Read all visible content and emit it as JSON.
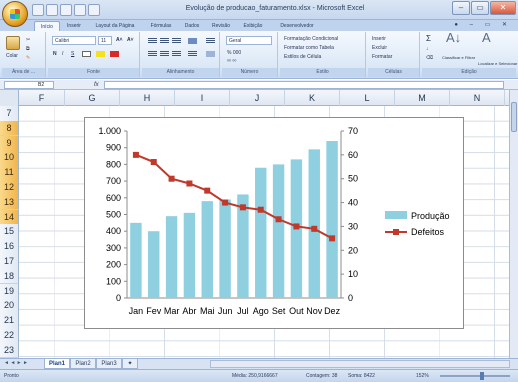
{
  "window": {
    "title": "Evolução de producao_faturamento.xlsx - Microsoft Excel",
    "controls": [
      "–",
      "▭",
      "✕"
    ]
  },
  "ribbon": {
    "tabs": [
      "Início",
      "Inserir",
      "Layout da Página",
      "Fórmulas",
      "Dados",
      "Revisão",
      "Exibição",
      "Desenvolvedor"
    ],
    "active_tab": "Início",
    "groups": {
      "clipboard": {
        "label": "Área de ...",
        "paste": "Colar"
      },
      "font": {
        "label": "Fonte",
        "font_name": "Calibri",
        "font_size": "11",
        "bold": "N",
        "italic": "I",
        "underline": "S"
      },
      "alignment": {
        "label": "Alinhamento"
      },
      "number": {
        "label": "Número",
        "format": "Geral",
        "percent": "% 000"
      },
      "styles": {
        "label": "Estilo",
        "items": [
          "Formatação Condicional",
          "Formatar como Tabela",
          "Estilos de Célula"
        ]
      },
      "cells": {
        "label": "Células",
        "items": [
          "Inserir",
          "Excluir",
          "Formatar"
        ]
      },
      "editing": {
        "label": "Edição",
        "sort": "Classificar e Filtrar",
        "find": "Localizar e Selecionar"
      }
    }
  },
  "formula_bar": {
    "name_box": "B2",
    "fx": "fx",
    "value": ""
  },
  "sheet": {
    "columns": [
      "F",
      "G",
      "H",
      "I",
      "J",
      "K",
      "L",
      "M",
      "N"
    ],
    "rows": [
      "7",
      "8",
      "9",
      "10",
      "11",
      "12",
      "13",
      "14",
      "15",
      "16",
      "17",
      "18",
      "19",
      "20",
      "21",
      "22",
      "23"
    ],
    "selected_rows": [
      "8",
      "9",
      "10",
      "11",
      "12",
      "13",
      "14"
    ]
  },
  "chart_data": {
    "type": "bar",
    "categories": [
      "Jan",
      "Fev",
      "Mar",
      "Abr",
      "Mai",
      "Jun",
      "Jul",
      "Ago",
      "Set",
      "Out",
      "Nov",
      "Dez"
    ],
    "series": [
      {
        "name": "Produção",
        "type": "bar",
        "axis": "left",
        "color": "#8ecfe0",
        "values": [
          450,
          400,
          490,
          510,
          580,
          590,
          620,
          780,
          800,
          830,
          890,
          940
        ]
      },
      {
        "name": "Defeitos",
        "type": "line",
        "axis": "right",
        "color": "#c0392b",
        "values": [
          60,
          57,
          50,
          48,
          45,
          40,
          38,
          37,
          33,
          30,
          29,
          25
        ]
      }
    ],
    "y_left": {
      "min": 0,
      "max": 1000,
      "ticks": [
        "0",
        "100",
        "200",
        "300",
        "400",
        "500",
        "600",
        "700",
        "800",
        "900",
        "1.000"
      ]
    },
    "y_right": {
      "min": 0,
      "max": 70,
      "ticks": [
        "0",
        "10",
        "20",
        "30",
        "40",
        "50",
        "60",
        "70"
      ]
    },
    "legend_position": "right",
    "gridlines": false
  },
  "sheet_tabs": {
    "tabs": [
      "Plan1",
      "Plan2",
      "Plan3"
    ],
    "active": "Plan1",
    "nav": "◄ ◄ ► ►"
  },
  "status_bar": {
    "mode": "Pronto",
    "average": "Média: 250,9166667",
    "count": "Contagem: 38",
    "sum": "Soma: 8422",
    "zoom": "152%"
  }
}
